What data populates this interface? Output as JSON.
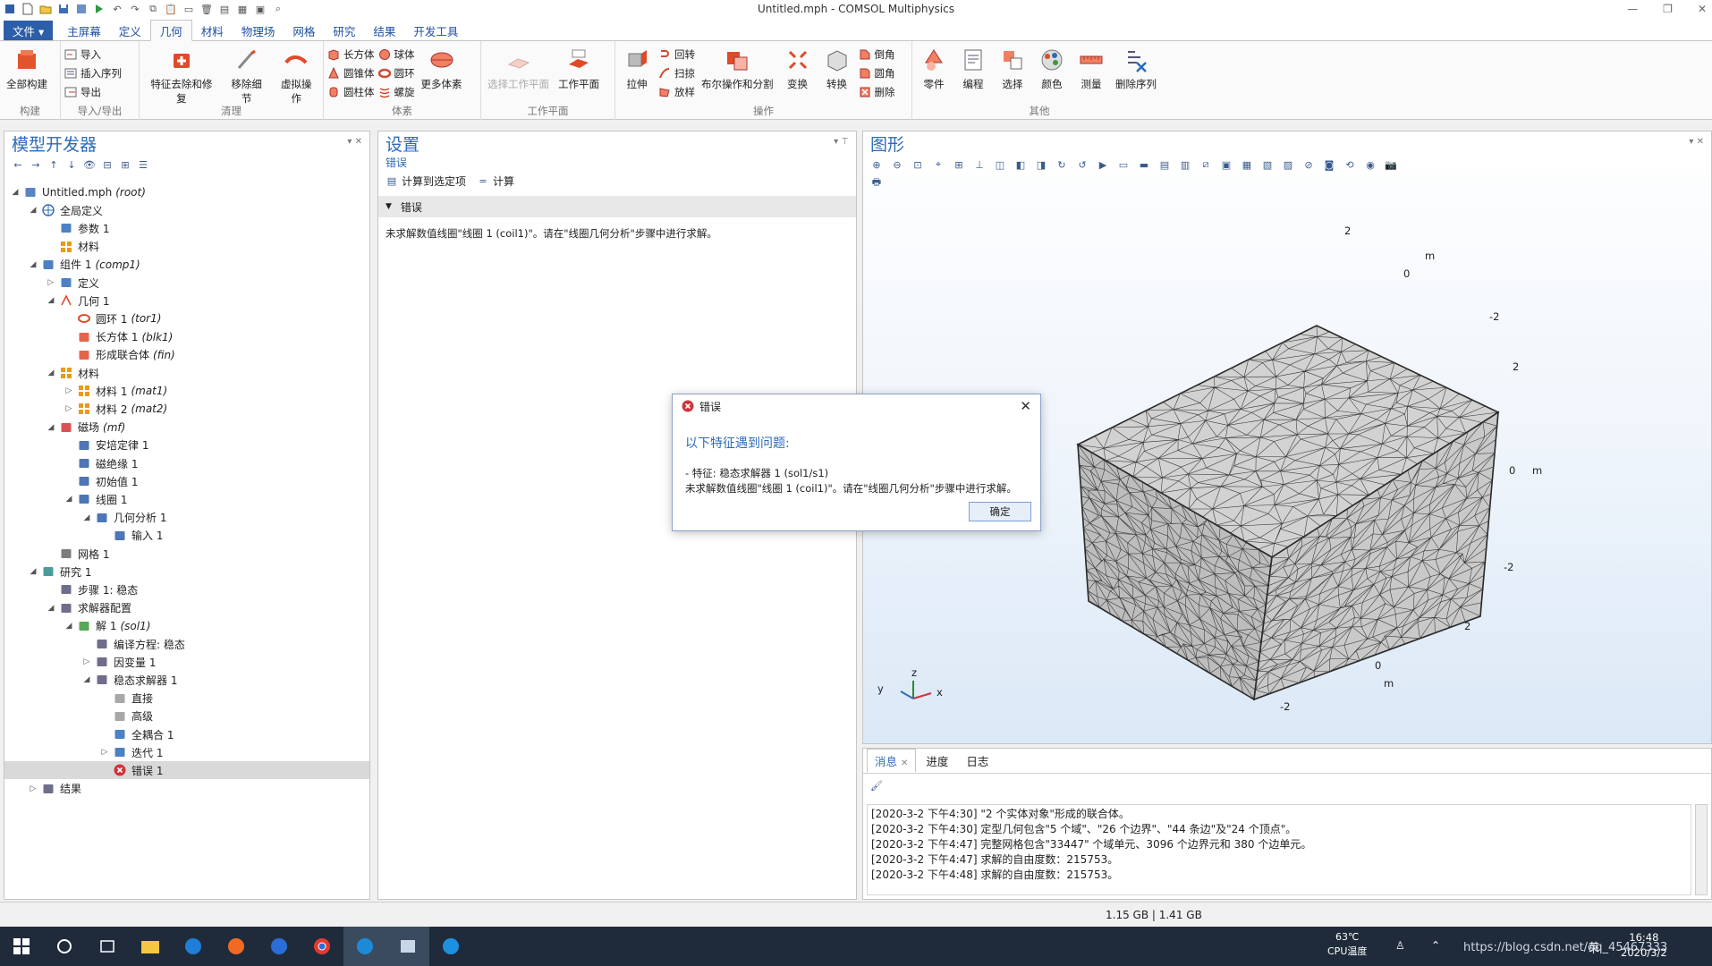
{
  "window": {
    "title": "Untitled.mph - COMSOL Multiphysics"
  },
  "ribbon_tabs": [
    "文件 ▾",
    "主屏幕",
    "定义",
    "几何",
    "材料",
    "物理场",
    "网格",
    "研究",
    "结果",
    "开发工具"
  ],
  "ribbon": {
    "build": {
      "label": "构建",
      "all": "全部构建"
    },
    "io": {
      "label": "导入/导出",
      "import": "导入",
      "insert": "插入序列",
      "export": "导出"
    },
    "clean": {
      "label": "清理",
      "defeature": "特征去除和修复",
      "remove": "移除细节",
      "virtual": "虚拟操作"
    },
    "prims": {
      "label": "体素",
      "block": "长方体",
      "sphere": "球体",
      "cyl": "圆锥体",
      "torus": "圆环",
      "cylinder": "圆柱体",
      "helix": "螺旋",
      "more": "更多体素"
    },
    "wp": {
      "label": "工作平面",
      "select": "选择工作平面",
      "plane": "工作平面"
    },
    "ops": {
      "label": "操作",
      "extrude": "拉伸",
      "revolve": "回转",
      "sweep": "扫掠",
      "loft": "放样",
      "boolean": "布尔操作和分割",
      "transform": "变换",
      "convert": "转换",
      "chamfer": "倒角",
      "fillet": "圆角",
      "delete": "删除"
    },
    "other": {
      "label": "其他",
      "parts": "零件",
      "program": "编程",
      "select": "选择",
      "color": "颜色",
      "measure": "测量",
      "delseq": "删除序列"
    }
  },
  "model_builder": {
    "title": "模型开发器",
    "tree": [
      {
        "label": "Untitled.mph",
        "tag": "(root)",
        "level": 0,
        "twisty": "open",
        "icon": "root"
      },
      {
        "label": "全局定义",
        "tag": "",
        "level": 1,
        "twisty": "open",
        "icon": "globe"
      },
      {
        "label": "参数 1",
        "tag": "",
        "level": 2,
        "twisty": "",
        "icon": "param"
      },
      {
        "label": "材料",
        "tag": "",
        "level": 2,
        "twisty": "",
        "icon": "mat"
      },
      {
        "label": "组件 1",
        "tag": "(comp1)",
        "level": 1,
        "twisty": "open",
        "icon": "comp"
      },
      {
        "label": "定义",
        "tag": "",
        "level": 2,
        "twisty": "closed",
        "icon": "def"
      },
      {
        "label": "几何 1",
        "tag": "",
        "level": 2,
        "twisty": "open",
        "icon": "geom"
      },
      {
        "label": "圆环 1",
        "tag": "(tor1)",
        "level": 3,
        "twisty": "",
        "icon": "torus"
      },
      {
        "label": "长方体 1",
        "tag": "(blk1)",
        "level": 3,
        "twisty": "",
        "icon": "block"
      },
      {
        "label": "形成联合体",
        "tag": "(fin)",
        "level": 3,
        "twisty": "",
        "icon": "union"
      },
      {
        "label": "材料",
        "tag": "",
        "level": 2,
        "twisty": "open",
        "icon": "mat"
      },
      {
        "label": "材料 1",
        "tag": "(mat1)",
        "level": 3,
        "twisty": "closed",
        "icon": "mat"
      },
      {
        "label": "材料 2",
        "tag": "(mat2)",
        "level": 3,
        "twisty": "closed",
        "icon": "mat"
      },
      {
        "label": "磁场",
        "tag": "(mf)",
        "level": 2,
        "twisty": "open",
        "icon": "magnet"
      },
      {
        "label": "安培定律 1",
        "tag": "",
        "level": 3,
        "twisty": "",
        "icon": "folder"
      },
      {
        "label": "磁绝缘 1",
        "tag": "",
        "level": 3,
        "twisty": "",
        "icon": "folder"
      },
      {
        "label": "初始值 1",
        "tag": "",
        "level": 3,
        "twisty": "",
        "icon": "folder"
      },
      {
        "label": "线圈 1",
        "tag": "",
        "level": 3,
        "twisty": "open",
        "icon": "folder"
      },
      {
        "label": "几何分析 1",
        "tag": "",
        "level": 4,
        "twisty": "open",
        "icon": "folder"
      },
      {
        "label": "输入 1",
        "tag": "",
        "level": 5,
        "twisty": "",
        "icon": "folder"
      },
      {
        "label": "网格 1",
        "tag": "",
        "level": 2,
        "twisty": "",
        "icon": "mesh"
      },
      {
        "label": "研究 1",
        "tag": "",
        "level": 1,
        "twisty": "open",
        "icon": "study"
      },
      {
        "label": "步骤 1: 稳态",
        "tag": "",
        "level": 2,
        "twisty": "",
        "icon": "step"
      },
      {
        "label": "求解器配置",
        "tag": "",
        "level": 2,
        "twisty": "open",
        "icon": "solver"
      },
      {
        "label": "解 1",
        "tag": "(sol1)",
        "level": 3,
        "twisty": "open",
        "icon": "sol"
      },
      {
        "label": "编译方程: 稳态",
        "tag": "",
        "level": 4,
        "twisty": "",
        "icon": "compile"
      },
      {
        "label": "因变量 1",
        "tag": "",
        "level": 4,
        "twisty": "closed",
        "icon": "dep"
      },
      {
        "label": "稳态求解器 1",
        "tag": "",
        "level": 4,
        "twisty": "open",
        "icon": "stat"
      },
      {
        "label": "直接",
        "tag": "",
        "level": 5,
        "twisty": "",
        "icon": "direct"
      },
      {
        "label": "高级",
        "tag": "",
        "level": 5,
        "twisty": "",
        "icon": "adv"
      },
      {
        "label": "全耦合 1",
        "tag": "",
        "level": 5,
        "twisty": "",
        "icon": "coupled"
      },
      {
        "label": "迭代 1",
        "tag": "",
        "level": 5,
        "twisty": "closed",
        "icon": "iter"
      },
      {
        "label": "错误 1",
        "tag": "",
        "level": 5,
        "twisty": "",
        "icon": "error",
        "selected": true
      },
      {
        "label": "结果",
        "tag": "",
        "level": 1,
        "twisty": "closed",
        "icon": "results"
      }
    ]
  },
  "settings": {
    "title": "设置",
    "subtitle": "错误",
    "compute_selected": "计算到选定项",
    "compute": "计算",
    "section": "错误",
    "message": "未求解数值线圈\"线圈 1 (coil1)\"。请在\"线圈几何分析\"步骤中进行求解。"
  },
  "graphics": {
    "title": "图形",
    "axis_labels": {
      "top_2": "2",
      "top_m": "m",
      "top_0": "0",
      "top_neg2": "-2",
      "right_2": "2",
      "right_0": "0",
      "right_m": "m",
      "right_neg2": "-2",
      "bot_2": "2",
      "bot_0": "0",
      "bot_m": "m",
      "bot_neg2": "-2"
    },
    "triad": {
      "z": "z",
      "y": "y",
      "x": "x"
    }
  },
  "dialog": {
    "title": "错误",
    "heading": "以下特征遇到问题:",
    "line1": " - 特征: 稳态求解器 1 (sol1/s1)",
    "line2": "未求解数值线圈\"线圈 1 (coil1)\"。请在\"线圈几何分析\"步骤中进行求解。",
    "ok": "确定"
  },
  "messages": {
    "tabs": [
      "消息",
      "进度",
      "日志"
    ],
    "log": [
      "[2020-3-2 下午4:30] \"2 个实体对象\"形成的联合体。",
      "[2020-3-2 下午4:30] 定型几何包含\"5 个域\"、\"26 个边界\"、\"44 条边\"及\"24 个顶点\"。",
      "[2020-3-2 下午4:47] 完整网格包含\"33447\" 个域单元、3096 个边界元和 380 个边单元。",
      "[2020-3-2 下午4:47] 求解的自由度数：215753。",
      "[2020-3-2 下午4:48] 求解的自由度数：215753。"
    ]
  },
  "status": {
    "memory": "1.15 GB | 1.41 GB"
  },
  "taskbar": {
    "temp": "63℃",
    "temp_label": "CPU温度",
    "ime": "英",
    "time": "16:48",
    "date": "2020/3/2",
    "watermark": "https://blog.csdn.net/qq_45467333"
  },
  "colors": {
    "accent": "#2d6bb8",
    "file_tab": "#2d5ea8",
    "error": "#d0343a",
    "taskbar": "#1f2b3a"
  }
}
